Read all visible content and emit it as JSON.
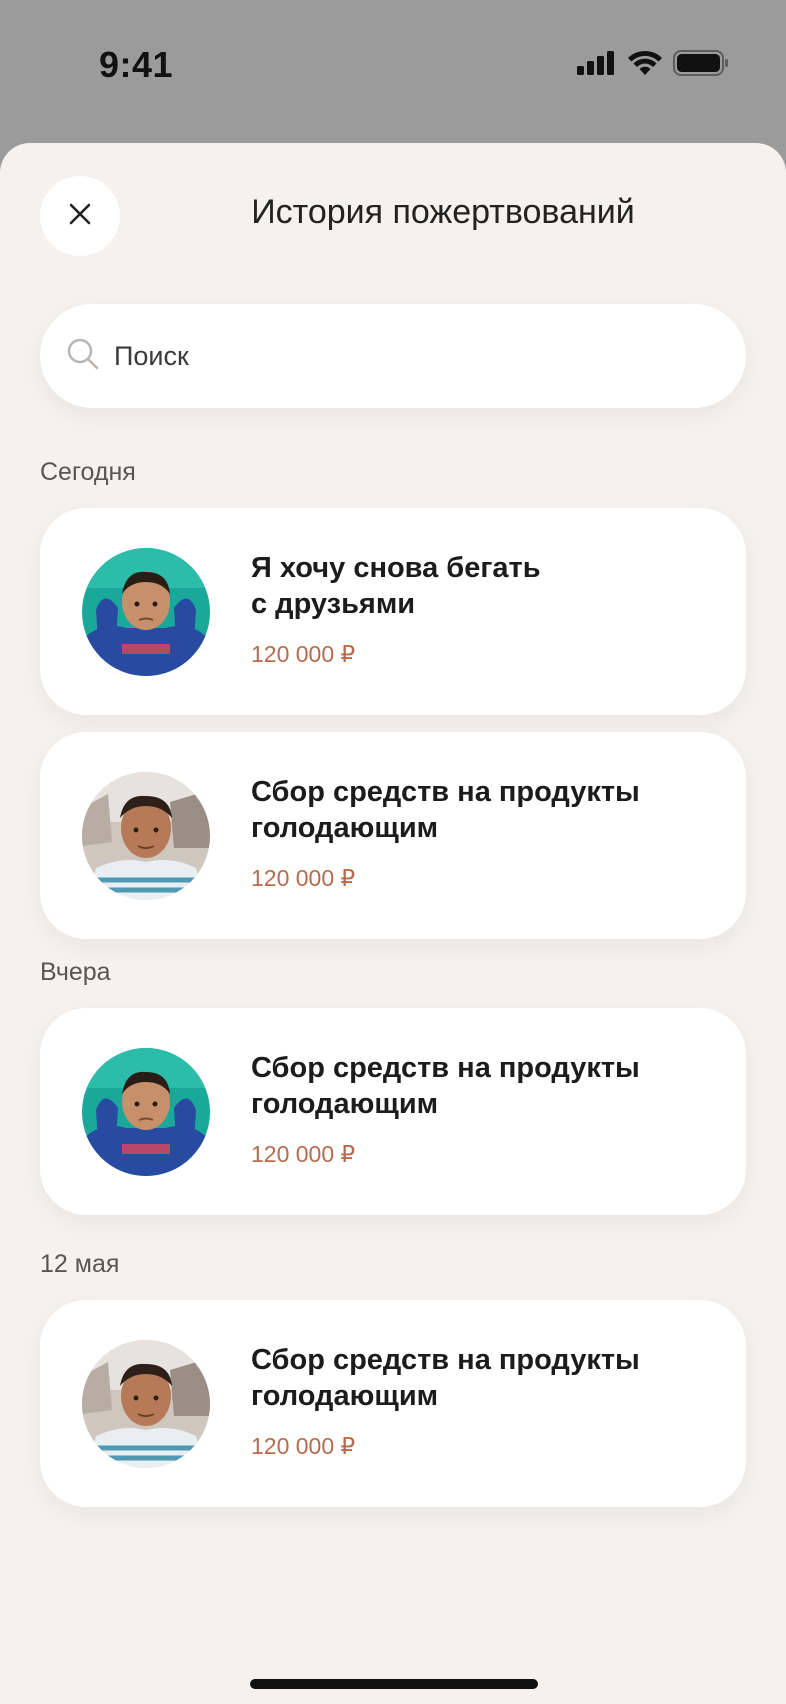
{
  "status_bar": {
    "time": "9:41"
  },
  "header": {
    "title": "История пожертвований"
  },
  "search": {
    "placeholder": "Поиск"
  },
  "sections": [
    {
      "label": "Сегодня",
      "items": [
        {
          "title_line1": "Я хочу снова бегать",
          "title_line2": "с друзьями",
          "amount": "120 000 ₽"
        },
        {
          "title_line1": "Сбор средств на продукты",
          "title_line2": "голодающим",
          "amount": "120 000 ₽"
        }
      ]
    },
    {
      "label": "Вчера",
      "items": [
        {
          "title_line1": "Сбор средств на продукты",
          "title_line2": "голодающим",
          "amount": "120 000 ₽"
        }
      ]
    },
    {
      "label": "12 мая",
      "items": [
        {
          "title_line1": "Сбор средств на продукты",
          "title_line2": "голодающим",
          "amount": "120 000 ₽"
        }
      ]
    }
  ],
  "colors": {
    "backdrop": "#9b9b9b",
    "sheet_background": "#f4f1ee",
    "card_background": "#ffffff",
    "amount": "#b86a4e"
  },
  "icons": [
    "signal-icon",
    "wifi-icon",
    "battery-icon",
    "close-icon",
    "search-icon"
  ]
}
